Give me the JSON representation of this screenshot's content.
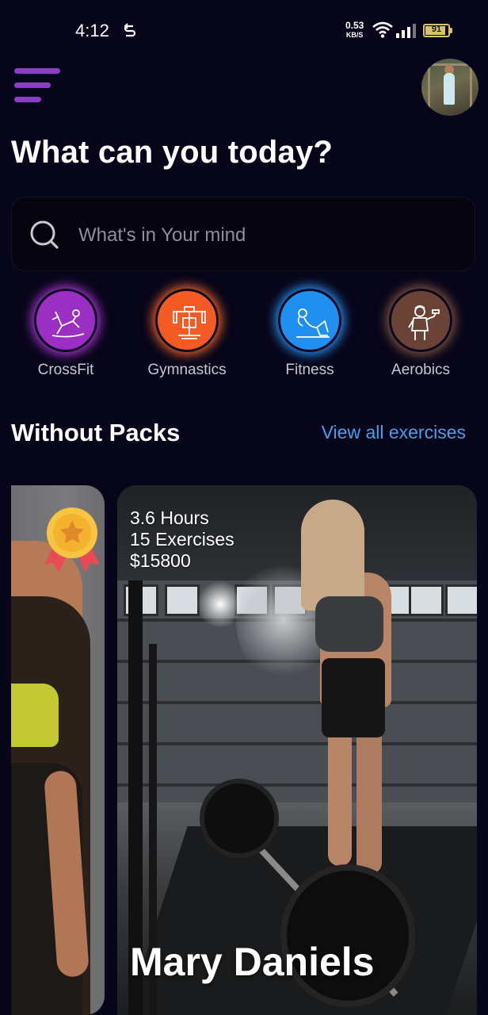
{
  "status_bar": {
    "time": "4:12",
    "sync_icon": "sync-s-icon",
    "net_speed": "0.53",
    "net_unit": "KB/S",
    "battery": "91",
    "battery_level": 0.91
  },
  "header": {
    "menu_icon": "hamburger-menu-icon",
    "title": "What can you today?"
  },
  "search": {
    "placeholder": "What's in Your mind",
    "icon": "search-icon"
  },
  "categories": [
    {
      "label": "CrossFit",
      "icon": "crossfit-icon",
      "color": "#9b2fc4",
      "glow": "#b43be0"
    },
    {
      "label": "Gymnastics",
      "icon": "gym-machine-icon",
      "color": "#f45b24",
      "glow": "#ff6a2a"
    },
    {
      "label": "Fitness",
      "icon": "situp-icon",
      "color": "#1f8ff0",
      "glow": "#2d9bff"
    },
    {
      "label": "Aerobics",
      "icon": "aerobics-icon",
      "color": "#6b4336",
      "glow": "#8a5a45"
    }
  ],
  "section": {
    "title": "Without Packs",
    "view_all": "View all exercises",
    "accent": "#4a9ee8"
  },
  "cards": [
    {
      "badge_icon": "medal-icon"
    },
    {
      "hours": "3.6 Hours",
      "exercises": "15 Exercises",
      "price": "$15800",
      "name": "Mary Daniels"
    }
  ]
}
